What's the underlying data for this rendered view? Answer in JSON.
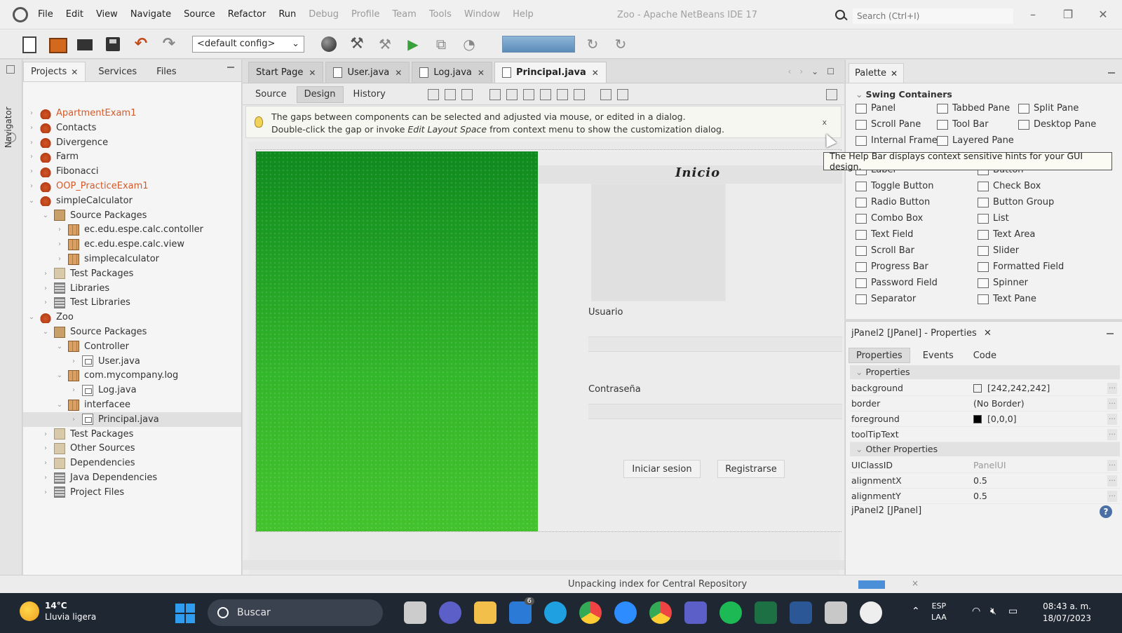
{
  "menubar": {
    "items": [
      "File",
      "Edit",
      "View",
      "Navigate",
      "Source",
      "Refactor",
      "Run",
      "Debug",
      "Profile",
      "Team",
      "Tools",
      "Window",
      "Help"
    ],
    "window_title": "Zoo - Apache NetBeans IDE 17",
    "search_placeholder": "Search (Ctrl+I)"
  },
  "toolbar": {
    "config": "<default config>"
  },
  "side_strip": {
    "navigator_label": "Navigator"
  },
  "projects_panel": {
    "tabs": [
      "Projects",
      "Services",
      "Files"
    ],
    "tree": [
      {
        "label": "ApartmentExam1",
        "icon": "java-project-icon",
        "depth": 0,
        "orange": true,
        "expanded": false
      },
      {
        "label": "Contacts",
        "icon": "java-project-icon",
        "depth": 0,
        "orange": false,
        "expanded": false
      },
      {
        "label": "Divergence",
        "icon": "java-project-icon",
        "depth": 0,
        "orange": false,
        "expanded": false
      },
      {
        "label": "Farm",
        "icon": "java-project-icon",
        "depth": 0,
        "orange": false,
        "expanded": false
      },
      {
        "label": "Fibonacci",
        "icon": "java-project-icon",
        "depth": 0,
        "orange": false,
        "expanded": false
      },
      {
        "label": "OOP_PracticeExam1",
        "icon": "java-project-icon",
        "depth": 0,
        "orange": true,
        "expanded": false
      },
      {
        "label": "simpleCalculator",
        "icon": "java-project-icon",
        "depth": 0,
        "orange": false,
        "expanded": true
      },
      {
        "label": "Source Packages",
        "icon": "source-packages-icon",
        "depth": 1,
        "orange": false,
        "expanded": true
      },
      {
        "label": "ec.edu.espe.calc.contoller",
        "icon": "package-icon",
        "depth": 2,
        "orange": false,
        "expanded": false
      },
      {
        "label": "ec.edu.espe.calc.view",
        "icon": "package-icon",
        "depth": 2,
        "orange": false,
        "expanded": false
      },
      {
        "label": "simplecalculator",
        "icon": "package-icon",
        "depth": 2,
        "orange": false,
        "expanded": false
      },
      {
        "label": "Test Packages",
        "icon": "folder-icon",
        "depth": 1,
        "orange": false,
        "expanded": false
      },
      {
        "label": "Libraries",
        "icon": "library-icon",
        "depth": 1,
        "orange": false,
        "expanded": false
      },
      {
        "label": "Test Libraries",
        "icon": "library-icon",
        "depth": 1,
        "orange": false,
        "expanded": false
      },
      {
        "label": "Zoo",
        "icon": "java-project-icon",
        "depth": 0,
        "orange": false,
        "expanded": true
      },
      {
        "label": "Source Packages",
        "icon": "source-packages-icon",
        "depth": 1,
        "orange": false,
        "expanded": true
      },
      {
        "label": "Controller",
        "icon": "package-icon",
        "depth": 2,
        "orange": false,
        "expanded": true
      },
      {
        "label": "User.java",
        "icon": "java-file-icon",
        "depth": 3,
        "orange": false,
        "expanded": false
      },
      {
        "label": "com.mycompany.log",
        "icon": "package-icon",
        "depth": 2,
        "orange": false,
        "expanded": true
      },
      {
        "label": "Log.java",
        "icon": "java-file-icon",
        "depth": 3,
        "orange": false,
        "expanded": false
      },
      {
        "label": "interfacee",
        "icon": "package-icon",
        "depth": 2,
        "orange": false,
        "expanded": true
      },
      {
        "label": "Principal.java",
        "icon": "form-file-icon",
        "depth": 3,
        "orange": false,
        "expanded": false,
        "selected": true
      },
      {
        "label": "Test Packages",
        "icon": "folder-icon",
        "depth": 1,
        "orange": false,
        "expanded": false
      },
      {
        "label": "Other Sources",
        "icon": "folder-icon",
        "depth": 1,
        "orange": false,
        "expanded": false
      },
      {
        "label": "Dependencies",
        "icon": "folder-icon",
        "depth": 1,
        "orange": false,
        "expanded": false
      },
      {
        "label": "Java Dependencies",
        "icon": "library-icon",
        "depth": 1,
        "orange": false,
        "expanded": false
      },
      {
        "label": "Project Files",
        "icon": "library-icon",
        "depth": 1,
        "orange": false,
        "expanded": false
      }
    ]
  },
  "editor": {
    "tabs": [
      {
        "label": "Start Page",
        "active": false,
        "file": false
      },
      {
        "label": "User.java",
        "active": false,
        "file": true
      },
      {
        "label": "Log.java",
        "active": false,
        "file": true
      },
      {
        "label": "Principal.java",
        "active": true,
        "file": true
      }
    ],
    "subtabs": [
      "Source",
      "Design",
      "History"
    ],
    "active_subtab": "Design",
    "help_line1": "The gaps between components can be selected and adjusted via mouse, or edited in a dialog.",
    "help_line2_a": "Double-click the gap or invoke ",
    "help_line2_em": "Edit Layout Space",
    "help_line2_b": " from context menu to show the customization dialog.",
    "help_close": "x",
    "form": {
      "title": "Inicio",
      "user_label": "Usuario",
      "password_label": "Contraseña",
      "login_button": "Iniciar sesion",
      "register_button": "Registrarse"
    }
  },
  "palette": {
    "title": "Palette",
    "category": "Swing Containers",
    "tooltip": "The Help Bar displays context sensitive hints for your GUI design.",
    "items": [
      {
        "label": "Panel",
        "icon": "panel-icon"
      },
      {
        "label": "Tabbed Pane",
        "icon": "tabbed-pane-icon"
      },
      {
        "label": "Split Pane",
        "icon": "split-pane-icon"
      },
      {
        "label": "Scroll Pane",
        "icon": "scroll-pane-icon"
      },
      {
        "label": "Tool Bar",
        "icon": "tool-bar-icon"
      },
      {
        "label": "Desktop Pane",
        "icon": "desktop-pane-icon"
      },
      {
        "label": "Internal Frame",
        "icon": "internal-frame-icon"
      },
      {
        "label": "Layered Pane",
        "icon": "layered-pane-icon"
      },
      {
        "label": "Label",
        "icon": "label-icon"
      },
      {
        "label": "Button",
        "icon": "button-icon"
      },
      {
        "label": "Toggle Button",
        "icon": "toggle-button-icon"
      },
      {
        "label": "Check Box",
        "icon": "check-box-icon"
      },
      {
        "label": "Radio Button",
        "icon": "radio-button-icon"
      },
      {
        "label": "Button Group",
        "icon": "button-group-icon"
      },
      {
        "label": "Combo Box",
        "icon": "combo-box-icon"
      },
      {
        "label": "List",
        "icon": "list-icon"
      },
      {
        "label": "Text Field",
        "icon": "text-field-icon"
      },
      {
        "label": "Text Area",
        "icon": "text-area-icon"
      },
      {
        "label": "Scroll Bar",
        "icon": "scroll-bar-icon"
      },
      {
        "label": "Slider",
        "icon": "slider-icon"
      },
      {
        "label": "Progress Bar",
        "icon": "progress-bar-icon"
      },
      {
        "label": "Formatted Field",
        "icon": "formatted-field-icon"
      },
      {
        "label": "Password Field",
        "icon": "password-field-icon"
      },
      {
        "label": "Spinner",
        "icon": "spinner-icon"
      },
      {
        "label": "Separator",
        "icon": "separator-icon"
      },
      {
        "label": "Text Pane",
        "icon": "text-pane-icon"
      }
    ]
  },
  "properties": {
    "title": "jPanel2 [JPanel] - Properties",
    "tabs": [
      "Properties",
      "Events",
      "Code"
    ],
    "section1": "Properties",
    "section2": "Other Properties",
    "rows": [
      {
        "name": "background",
        "value": "[242,242,242]",
        "swatch": "#f2f2f2"
      },
      {
        "name": "border",
        "value": "(No Border)",
        "swatch": ""
      },
      {
        "name": "foreground",
        "value": "[0,0,0]",
        "swatch": "#000000"
      },
      {
        "name": "toolTipText",
        "value": "",
        "swatch": ""
      },
      {
        "name": "UIClassID",
        "value": "PanelUI",
        "swatch": "",
        "dim": true
      },
      {
        "name": "alignmentX",
        "value": "0.5",
        "swatch": ""
      },
      {
        "name": "alignmentY",
        "value": "0.5",
        "swatch": ""
      }
    ],
    "footer": "jPanel2 [JPanel]"
  },
  "statusbar": {
    "text": "Unpacking index for Central Repository",
    "close": "×"
  },
  "taskbar": {
    "temperature": "14°C",
    "weather": "Lluvia ligera",
    "search": "Buscar",
    "lang_line1": "ESP",
    "lang_line2": "LAA",
    "time": "08:43 a. m.",
    "date": "18/07/2023",
    "badge": "6"
  }
}
